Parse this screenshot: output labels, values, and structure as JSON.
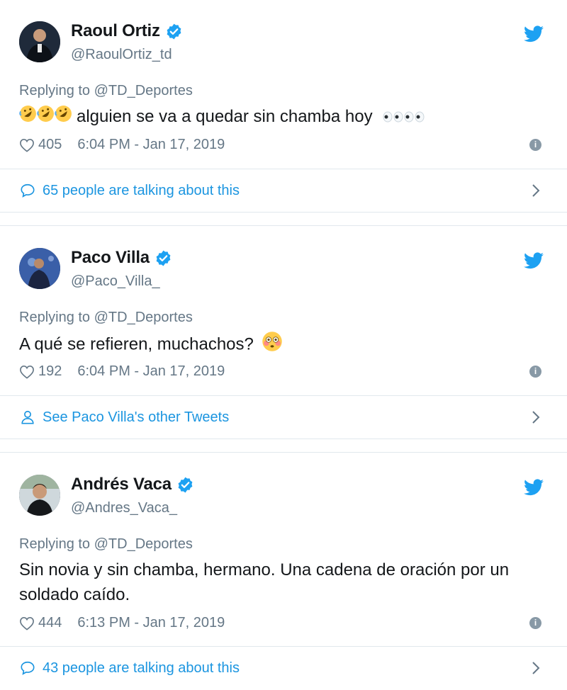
{
  "tweets": [
    {
      "name": "Raoul Ortiz",
      "handle": "@RaoulOrtiz_td",
      "replying_label": "Replying to",
      "replying_to": "@TD_Deportes",
      "text": "alguien se va a quedar sin chamba hoy",
      "leading_emoji": [
        "rofl-emoji",
        "rofl-emoji",
        "rofl-emoji"
      ],
      "trailing_emoji": [
        "eyes-emoji",
        "eyes-emoji"
      ],
      "likes": "405",
      "timestamp": "6:04 PM - Jan 17, 2019",
      "footer_label": "65 people are talking about this",
      "footer_icon": "speech-bubble-icon"
    },
    {
      "name": "Paco Villa",
      "handle": "@Paco_Villa_",
      "replying_label": "Replying to",
      "replying_to": "@TD_Deportes",
      "text": "A qué se refieren, muchachos?",
      "trailing_emoji": [
        "flushed-emoji"
      ],
      "likes": "192",
      "timestamp": "6:04 PM - Jan 17, 2019",
      "footer_label": "See Paco Villa's other Tweets",
      "footer_icon": "person-icon"
    },
    {
      "name": "Andrés Vaca",
      "handle": "@Andres_Vaca_",
      "replying_label": "Replying to",
      "replying_to": "@TD_Deportes",
      "text": "Sin novia y sin chamba, hermano. Una cadena de oración por un soldado caído.",
      "likes": "444",
      "timestamp": "6:13 PM - Jan 17, 2019",
      "footer_label": "43 people are talking about this",
      "footer_icon": "speech-bubble-icon"
    }
  ],
  "colors": {
    "twitter_blue": "#1da1f2",
    "link_blue": "#1b95e0",
    "secondary_text": "#657786",
    "divider": "#e1e8ed"
  }
}
